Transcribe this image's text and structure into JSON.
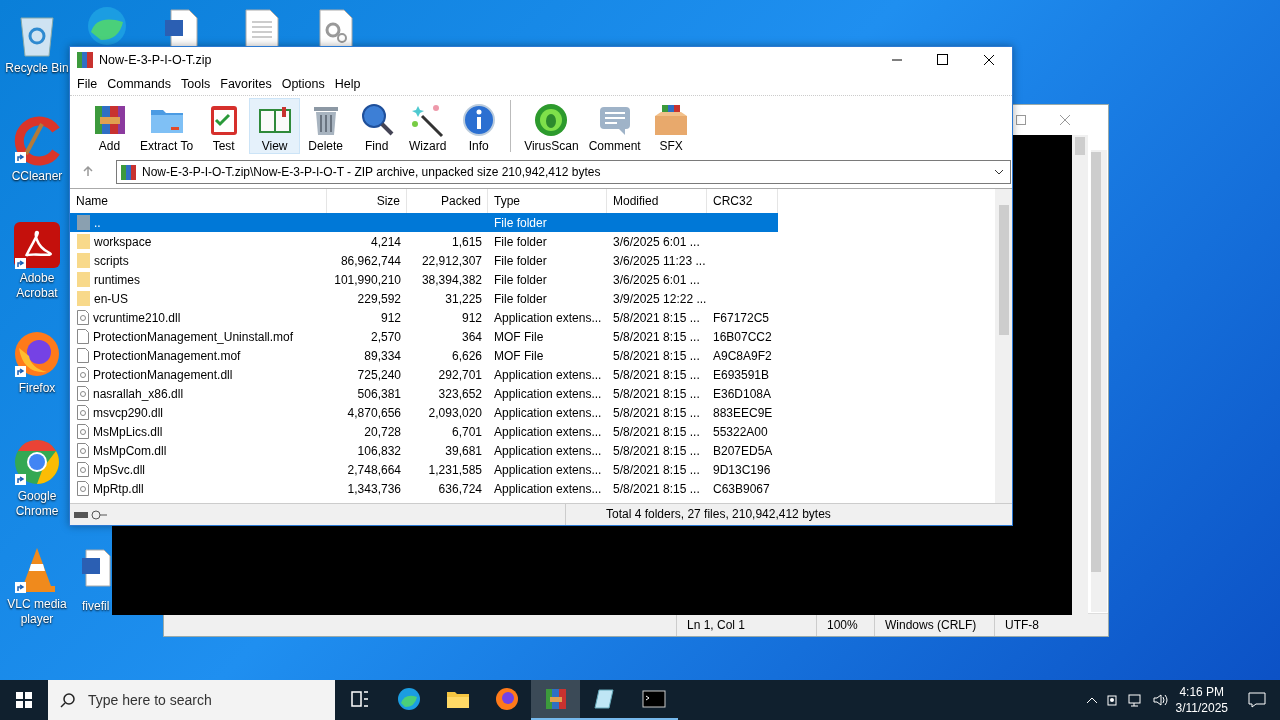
{
  "desktop_icons": [
    {
      "kind": "recycle",
      "label": "Recycle Bin"
    },
    {
      "kind": "ccleaner",
      "label": "CCleaner"
    },
    {
      "kind": "acrobat",
      "label": "Adobe Acrobat"
    },
    {
      "kind": "firefox",
      "label": "Firefox"
    },
    {
      "kind": "chrome",
      "label": "Google Chrome"
    },
    {
      "kind": "vlc",
      "label": "VLC media player"
    }
  ],
  "partial_icon": {
    "label": "fivefil"
  },
  "notepad": {
    "status": [
      "Ln 1, Col 1",
      "100%",
      "Windows (CRLF)",
      "UTF-8"
    ]
  },
  "winrar": {
    "title": "Now-E-3-P-I-O-T.zip",
    "menu": [
      "File",
      "Commands",
      "Tools",
      "Favorites",
      "Options",
      "Help"
    ],
    "toolbar": [
      {
        "kind": "add",
        "label": "Add",
        "selected": false
      },
      {
        "kind": "extract",
        "label": "Extract To",
        "selected": false
      },
      {
        "kind": "test",
        "label": "Test",
        "selected": false
      },
      {
        "kind": "view",
        "label": "View",
        "selected": true
      },
      {
        "kind": "delete",
        "label": "Delete",
        "selected": false
      },
      {
        "kind": "find",
        "label": "Find",
        "selected": false
      },
      {
        "kind": "wizard",
        "label": "Wizard",
        "selected": false
      },
      {
        "kind": "info",
        "label": "Info",
        "selected": false
      },
      {
        "kind": "virusscan",
        "label": "VirusScan",
        "selected": false
      },
      {
        "kind": "comment",
        "label": "Comment",
        "selected": false
      },
      {
        "kind": "sfx",
        "label": "SFX",
        "selected": false
      }
    ],
    "path": "Now-E-3-P-I-O-T.zip\\Now-E-3-P-I-O-T - ZIP archive, unpacked size 210,942,412 bytes",
    "columns": [
      "Name",
      "Size",
      "Packed",
      "Type",
      "Modified",
      "CRC32"
    ],
    "rows": [
      {
        "kind": "parent",
        "name": "..",
        "size": "",
        "packed": "",
        "type": "File folder",
        "modified": "",
        "crc": "",
        "selected": true
      },
      {
        "kind": "folder",
        "name": "workspace",
        "size": "4,214",
        "packed": "1,615",
        "type": "File folder",
        "modified": "3/6/2025 6:01 ...",
        "crc": "",
        "selected": false
      },
      {
        "kind": "folder",
        "name": "scripts",
        "size": "86,962,744",
        "packed": "22,912,307",
        "type": "File folder",
        "modified": "3/6/2025 11:23 ...",
        "crc": "",
        "selected": false
      },
      {
        "kind": "folder",
        "name": "runtimes",
        "size": "101,990,210",
        "packed": "38,394,382",
        "type": "File folder",
        "modified": "3/6/2025 6:01 ...",
        "crc": "",
        "selected": false
      },
      {
        "kind": "folder",
        "name": "en-US",
        "size": "229,592",
        "packed": "31,225",
        "type": "File folder",
        "modified": "3/9/2025 12:22 ...",
        "crc": "",
        "selected": false
      },
      {
        "kind": "dll",
        "name": "vcruntime210.dll",
        "size": "912",
        "packed": "912",
        "type": "Application extens...",
        "modified": "5/8/2021 8:15 ...",
        "crc": "F67172C5",
        "selected": false
      },
      {
        "kind": "file",
        "name": "ProtectionManagement_Uninstall.mof",
        "size": "2,570",
        "packed": "364",
        "type": "MOF File",
        "modified": "5/8/2021 8:15 ...",
        "crc": "16B07CC2",
        "selected": false
      },
      {
        "kind": "file",
        "name": "ProtectionManagement.mof",
        "size": "89,334",
        "packed": "6,626",
        "type": "MOF File",
        "modified": "5/8/2021 8:15 ...",
        "crc": "A9C8A9F2",
        "selected": false
      },
      {
        "kind": "dll",
        "name": "ProtectionManagement.dll",
        "size": "725,240",
        "packed": "292,701",
        "type": "Application extens...",
        "modified": "5/8/2021 8:15 ...",
        "crc": "E693591B",
        "selected": false
      },
      {
        "kind": "dll",
        "name": "nasrallah_x86.dll",
        "size": "506,381",
        "packed": "323,652",
        "type": "Application extens...",
        "modified": "5/8/2021 8:15 ...",
        "crc": "E36D108A",
        "selected": false
      },
      {
        "kind": "dll",
        "name": "msvcp290.dll",
        "size": "4,870,656",
        "packed": "2,093,020",
        "type": "Application extens...",
        "modified": "5/8/2021 8:15 ...",
        "crc": "883EEC9E",
        "selected": false
      },
      {
        "kind": "dll",
        "name": "MsMpLics.dll",
        "size": "20,728",
        "packed": "6,701",
        "type": "Application extens...",
        "modified": "5/8/2021 8:15 ...",
        "crc": "55322A00",
        "selected": false
      },
      {
        "kind": "dll",
        "name": "MsMpCom.dll",
        "size": "106,832",
        "packed": "39,681",
        "type": "Application extens...",
        "modified": "5/8/2021 8:15 ...",
        "crc": "B207ED5A",
        "selected": false
      },
      {
        "kind": "dll",
        "name": "MpSvc.dll",
        "size": "2,748,664",
        "packed": "1,231,585",
        "type": "Application extens...",
        "modified": "5/8/2021 8:15 ...",
        "crc": "9D13C196",
        "selected": false
      },
      {
        "kind": "dll",
        "name": "MpRtp.dll",
        "size": "1,343,736",
        "packed": "636,724",
        "type": "Application extens...",
        "modified": "5/8/2021 8:15 ...",
        "crc": "C63B9067",
        "selected": false
      }
    ],
    "status": "Total 4 folders, 27 files, 210,942,412 bytes"
  },
  "taskbar": {
    "search_placeholder": "Type here to search",
    "apps": [
      {
        "kind": "taskview",
        "running": false,
        "selected": false
      },
      {
        "kind": "edge",
        "running": false,
        "selected": false
      },
      {
        "kind": "explorer",
        "running": false,
        "selected": false
      },
      {
        "kind": "firefox",
        "running": false,
        "selected": false
      },
      {
        "kind": "winrar",
        "running": true,
        "selected": true
      },
      {
        "kind": "notepad",
        "running": true,
        "selected": false
      },
      {
        "kind": "cmd",
        "running": true,
        "selected": false
      }
    ],
    "time": "4:16 PM",
    "date": "3/11/2025"
  }
}
